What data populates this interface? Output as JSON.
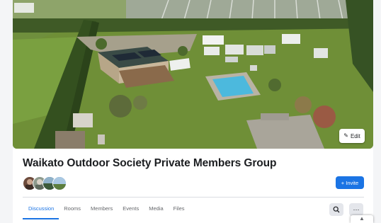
{
  "cover": {
    "edit_label": "Edit",
    "edit_icon": "pencil-icon"
  },
  "group": {
    "title": "Waikato Outdoor Society Private Members Group",
    "member_avatar_count": 4
  },
  "actions": {
    "invite_label": "+ Invite",
    "search_icon": "search-icon",
    "more_icon": "more-icon"
  },
  "tabs": [
    {
      "label": "Discussion",
      "active": true
    },
    {
      "label": "Rooms",
      "active": false
    },
    {
      "label": "Members",
      "active": false
    },
    {
      "label": "Events",
      "active": false
    },
    {
      "label": "Media",
      "active": false
    },
    {
      "label": "Files",
      "active": false
    }
  ],
  "colors": {
    "accent": "#1b74e4",
    "title_text": "#1c1e21",
    "secondary_text": "#65676b"
  }
}
